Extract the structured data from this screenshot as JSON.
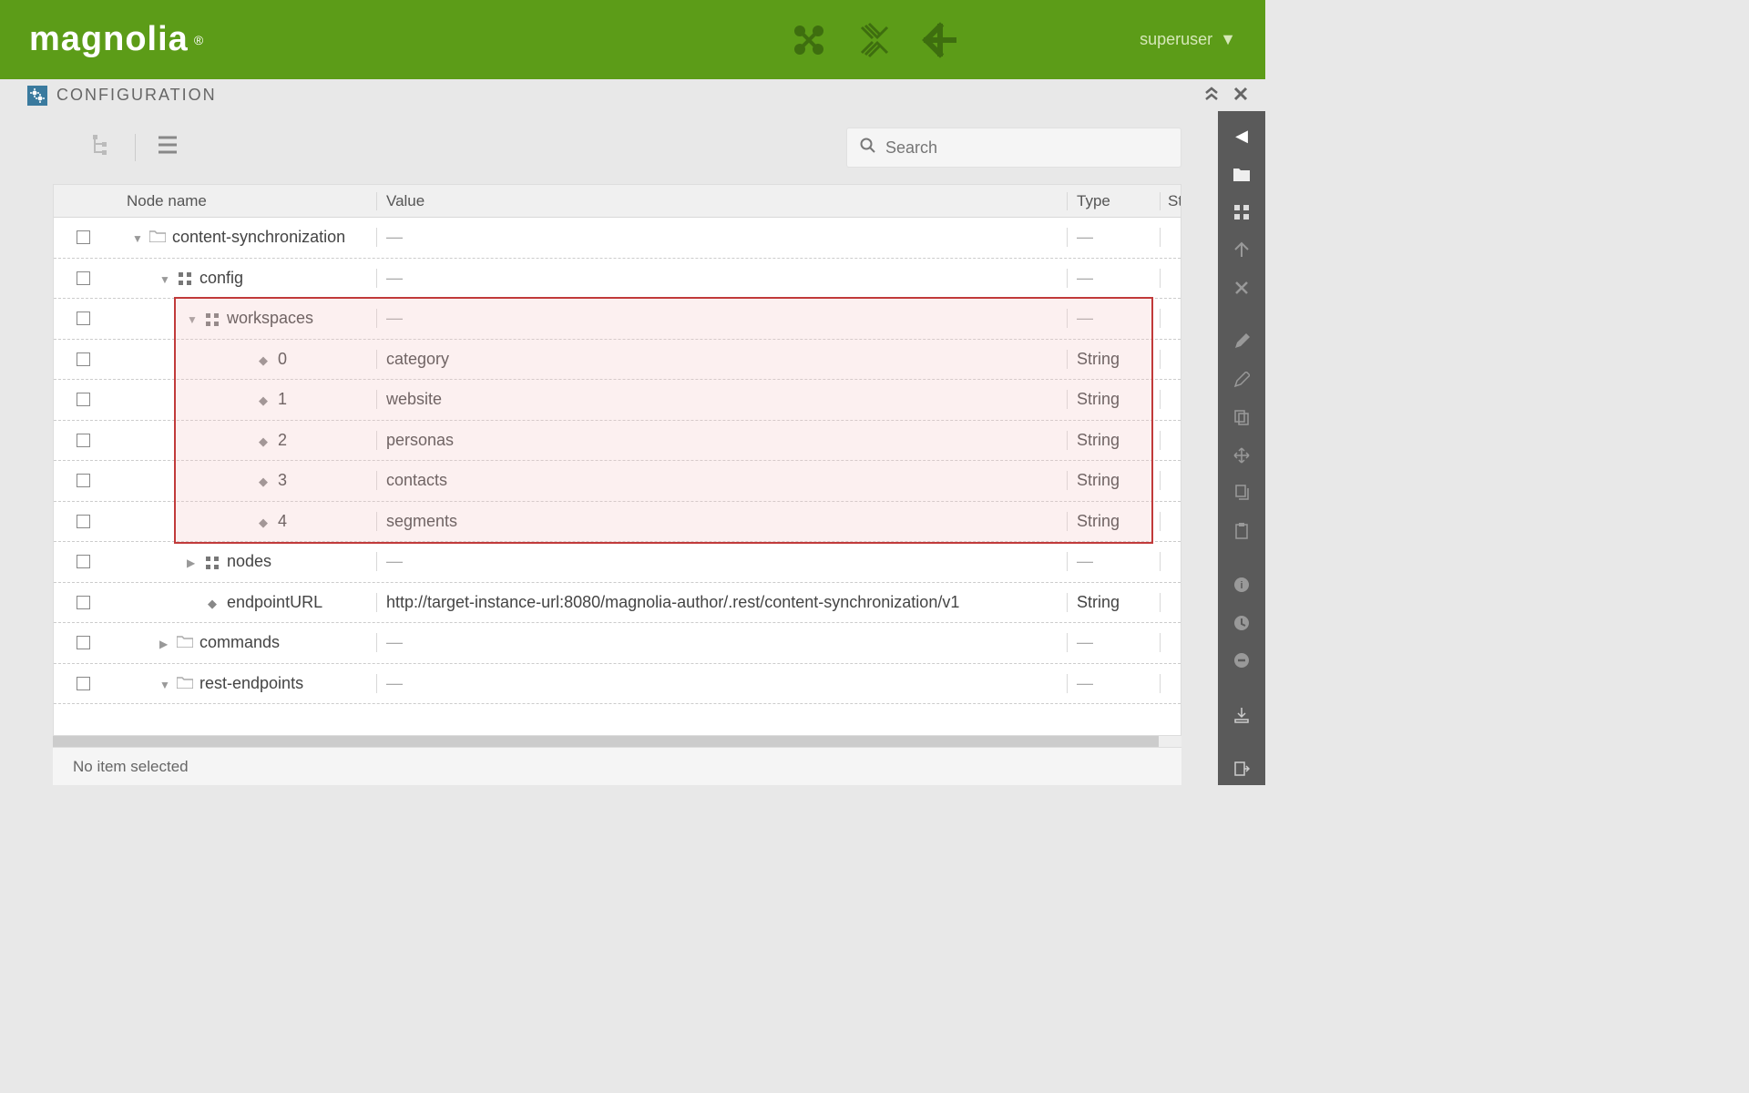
{
  "header": {
    "brand": "magnolia",
    "user": "superuser"
  },
  "page": {
    "title": "CONFIGURATION"
  },
  "search": {
    "placeholder": "Search"
  },
  "columns": {
    "name": "Node name",
    "value": "Value",
    "type": "Type",
    "st": "St"
  },
  "rows": [
    {
      "indent": 0,
      "icon": "folder",
      "expand": "down",
      "name": "content-synchronization",
      "value": "—",
      "type": "—"
    },
    {
      "indent": 1,
      "icon": "content",
      "expand": "down",
      "name": "config",
      "value": "—",
      "type": "—"
    },
    {
      "indent": 2,
      "icon": "content",
      "expand": "down",
      "name": "workspaces",
      "value": "—",
      "type": "—",
      "hl": true
    },
    {
      "indent": 3,
      "icon": "prop",
      "name": "0",
      "value": "category",
      "type": "String",
      "hl": true
    },
    {
      "indent": 3,
      "icon": "prop",
      "name": "1",
      "value": "website",
      "type": "String",
      "hl": true
    },
    {
      "indent": 3,
      "icon": "prop",
      "name": "2",
      "value": "personas",
      "type": "String",
      "hl": true
    },
    {
      "indent": 3,
      "icon": "prop",
      "name": "3",
      "value": "contacts",
      "type": "String",
      "hl": true
    },
    {
      "indent": 3,
      "icon": "prop",
      "name": "4",
      "value": "segments",
      "type": "String",
      "hl": true
    },
    {
      "indent": 2,
      "icon": "content",
      "expand": "right",
      "name": "nodes",
      "value": "—",
      "type": "—"
    },
    {
      "indent": 2,
      "icon": "prop",
      "name": "endpointURL",
      "value": "http://target-instance-url:8080/magnolia-author/.rest/content-synchronization/v1",
      "type": "String"
    },
    {
      "indent": 1,
      "icon": "folder",
      "expand": "right",
      "name": "commands",
      "value": "—",
      "type": "—"
    },
    {
      "indent": 1,
      "icon": "folder",
      "expand": "down",
      "name": "rest-endpoints",
      "value": "—",
      "type": "—"
    }
  ],
  "status": "No item selected"
}
